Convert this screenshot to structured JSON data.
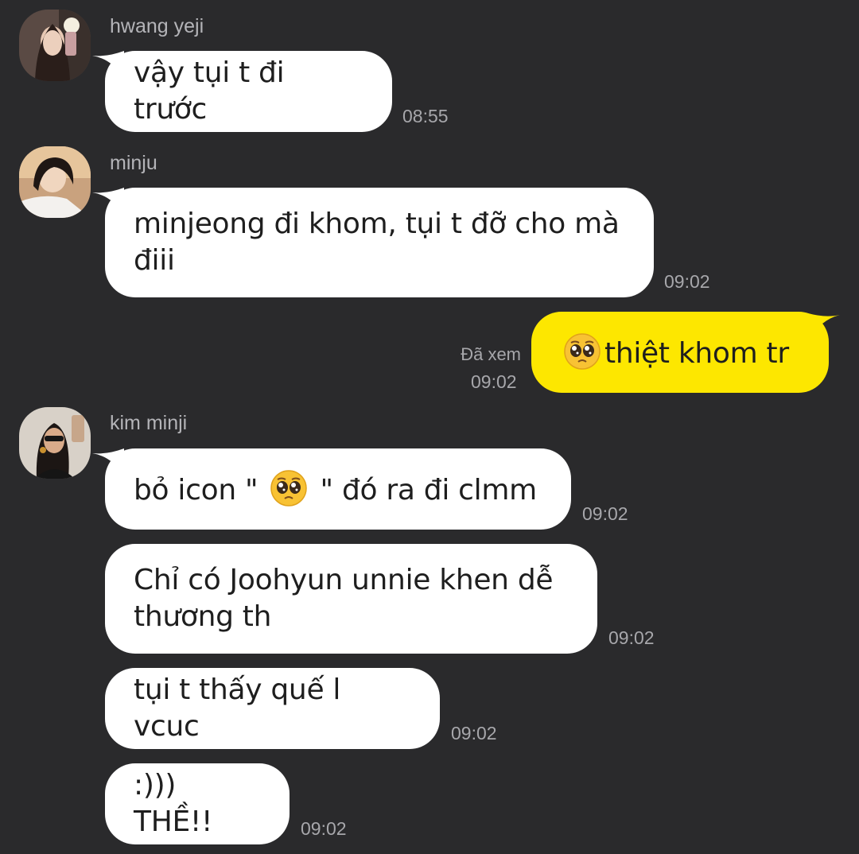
{
  "messages": [
    {
      "sender": "hwang yeji",
      "text": "vậy tụi t đi trước",
      "time": "08:55"
    },
    {
      "sender": "minju",
      "text": "minjeong đi khom, tụi t đỡ cho mà\nđiii",
      "time": "09:02"
    },
    {
      "mine": true,
      "emoji": "pleading-face-emoji",
      "text": "thiệt khom tr",
      "status": "Đã xem",
      "time": "09:02"
    },
    {
      "sender": "kim minji",
      "text_before": "bỏ icon \" ",
      "emoji": "pleading-face-emoji",
      "text_after": " \" đó ra đi clmm",
      "time": "09:02"
    },
    {
      "text": "Chỉ có Joohyun unnie khen dễ\nthương th",
      "time": "09:02"
    },
    {
      "text": "tụi t thấy quế l vcuc",
      "time": "09:02"
    },
    {
      "text": ":))) THỀ!!",
      "time": "09:02"
    }
  ],
  "colors": {
    "background": "#2a2a2c",
    "incoming_bubble": "#ffffff",
    "outgoing_bubble": "#fde700",
    "meta_text": "#a7a7ab"
  }
}
